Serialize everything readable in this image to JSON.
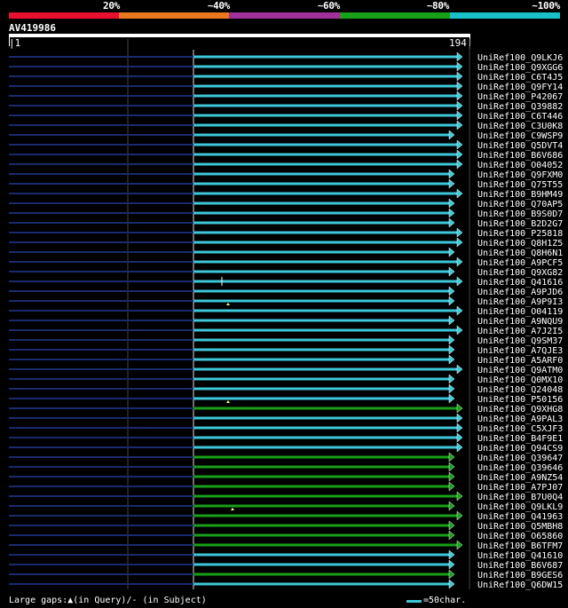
{
  "legend": {
    "colors": [
      "#e8102e",
      "#e8781e",
      "#a0309c",
      "#18a018",
      "#18c0c8"
    ],
    "labels": [
      "20%",
      "~40%",
      "~60%",
      "~80%",
      "~100%"
    ]
  },
  "query": {
    "name": "AV419986",
    "start": "|1",
    "end": "194|"
  },
  "colors": {
    "cyan": "#3cc8d8",
    "green": "#18a018",
    "navy": "#1a2a6e"
  },
  "hits": [
    {
      "name": "UniRef100_Q9LKJ6",
      "color": "cyan",
      "end": 520
    },
    {
      "name": "UniRef100_Q9XGG6",
      "color": "cyan",
      "end": 520
    },
    {
      "name": "UniRef100_C6T4J5",
      "color": "cyan",
      "end": 520
    },
    {
      "name": "UniRef100_Q9FY14",
      "color": "cyan",
      "end": 520
    },
    {
      "name": "UniRef100_P42067",
      "color": "cyan",
      "end": 520
    },
    {
      "name": "UniRef100_Q39882",
      "color": "cyan",
      "end": 520
    },
    {
      "name": "UniRef100_C6T446",
      "color": "cyan",
      "end": 520
    },
    {
      "name": "UniRef100_C3U0K8",
      "color": "cyan",
      "end": 520
    },
    {
      "name": "UniRef100_C9WSP9",
      "color": "cyan",
      "end": 511
    },
    {
      "name": "UniRef100_Q5DVT4",
      "color": "cyan",
      "end": 520
    },
    {
      "name": "UniRef100_B6V686",
      "color": "cyan",
      "end": 520
    },
    {
      "name": "UniRef100_O04052",
      "color": "cyan",
      "end": 520
    },
    {
      "name": "UniRef100_Q9FXM0",
      "color": "cyan",
      "end": 511
    },
    {
      "name": "UniRef100_Q75T55",
      "color": "cyan",
      "end": 511
    },
    {
      "name": "UniRef100_B9HM49",
      "color": "cyan",
      "end": 520
    },
    {
      "name": "UniRef100_Q70AP5",
      "color": "cyan",
      "end": 511
    },
    {
      "name": "UniRef100_B9S0D7",
      "color": "cyan",
      "end": 511
    },
    {
      "name": "UniRef100_B2D2G7",
      "color": "cyan",
      "end": 511
    },
    {
      "name": "UniRef100_P25818",
      "color": "cyan",
      "end": 520
    },
    {
      "name": "UniRef100_Q8H1Z5",
      "color": "cyan",
      "end": 520
    },
    {
      "name": "UniRef100_Q8H6N1",
      "color": "cyan",
      "end": 511
    },
    {
      "name": "UniRef100_A9PCF5",
      "color": "cyan",
      "end": 520
    },
    {
      "name": "UniRef100_Q9XG82",
      "color": "cyan",
      "end": 511
    },
    {
      "name": "UniRef100_Q41616",
      "color": "cyan",
      "end": 520,
      "gap_subject": true
    },
    {
      "name": "UniRef100_A9PJD6",
      "color": "cyan",
      "end": 511
    },
    {
      "name": "UniRef100_A9P9I3",
      "color": "cyan",
      "end": 511
    },
    {
      "name": "UniRef100_O04119",
      "color": "cyan",
      "end": 520,
      "gap_query": 257
    },
    {
      "name": "UniRef100_A9NQU9",
      "color": "cyan",
      "end": 511
    },
    {
      "name": "UniRef100_A7J2I5",
      "color": "cyan",
      "end": 520
    },
    {
      "name": "UniRef100_Q9SM37",
      "color": "cyan",
      "end": 511
    },
    {
      "name": "UniRef100_A7QJE3",
      "color": "cyan",
      "end": 511
    },
    {
      "name": "UniRef100_A5ARF0",
      "color": "cyan",
      "end": 511
    },
    {
      "name": "UniRef100_Q9ATM0",
      "color": "cyan",
      "end": 520
    },
    {
      "name": "UniRef100_Q0MX10",
      "color": "cyan",
      "end": 511
    },
    {
      "name": "UniRef100_Q24048",
      "color": "cyan",
      "end": 511
    },
    {
      "name": "UniRef100_P50156",
      "color": "cyan",
      "end": 511
    },
    {
      "name": "UniRef100_Q9XHG8",
      "color": "green",
      "end": 520,
      "gap_query": 257
    },
    {
      "name": "UniRef100_A9PAL3",
      "color": "cyan",
      "end": 520
    },
    {
      "name": "UniRef100_C5XJF3",
      "color": "cyan",
      "end": 520
    },
    {
      "name": "UniRef100_B4F9E1",
      "color": "cyan",
      "end": 520
    },
    {
      "name": "UniRef100_Q94CS9",
      "color": "cyan",
      "end": 520
    },
    {
      "name": "UniRef100_Q39647",
      "color": "green",
      "end": 511
    },
    {
      "name": "UniRef100_Q39646",
      "color": "green",
      "end": 511
    },
    {
      "name": "UniRef100_A9NZ54",
      "color": "green",
      "end": 511
    },
    {
      "name": "UniRef100_A7PJ07",
      "color": "green",
      "end": 511
    },
    {
      "name": "UniRef100_B7U0Q4",
      "color": "green",
      "end": 520
    },
    {
      "name": "UniRef100_Q9LKL9",
      "color": "green",
      "end": 511
    },
    {
      "name": "UniRef100_Q41963",
      "color": "green",
      "end": 520,
      "gap_query": 262
    },
    {
      "name": "UniRef100_Q5MBH8",
      "color": "green",
      "end": 511
    },
    {
      "name": "UniRef100_O65860",
      "color": "green",
      "end": 511
    },
    {
      "name": "UniRef100_B6TFM7",
      "color": "green",
      "end": 520
    },
    {
      "name": "UniRef100_Q41610",
      "color": "cyan",
      "end": 511
    },
    {
      "name": "UniRef100_B6V687",
      "color": "cyan",
      "end": 511
    },
    {
      "name": "UniRef100_B9GES6",
      "color": "green",
      "end": 511
    },
    {
      "name": "UniRef100_Q6DW15",
      "color": "cyan",
      "end": 511
    }
  ],
  "footer": {
    "gaps_text": "Large gaps:▲(in Query)/- (in Subject)",
    "scale_text": "=50char."
  }
}
